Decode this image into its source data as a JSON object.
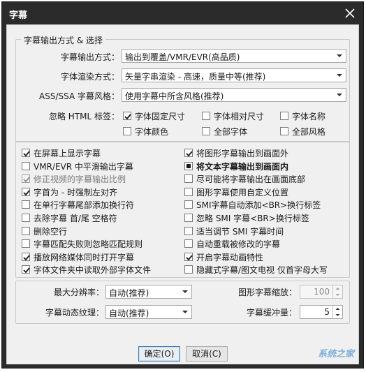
{
  "window": {
    "title": "字幕"
  },
  "output_group": {
    "title": "字幕输出方式 & 选择",
    "output_mode": {
      "label": "字幕输出方式：",
      "value": "输出到覆盖/VMR/EVR(高品质)"
    },
    "font_render": {
      "label": "字体渲染方式：",
      "value": "矢量字串渲染 - 高速，质量中等(推荐)"
    },
    "ass_style": {
      "label": "ASS/SSA 字幕风格：",
      "value": "使用字幕中所含风格(推荐)"
    },
    "html_tags": {
      "label": "忽略 HTML 标签：",
      "options": [
        {
          "label": "字体固定尺寸",
          "checked": true
        },
        {
          "label": "字体相对尺寸",
          "checked": false
        },
        {
          "label": "字体名称",
          "checked": false
        },
        {
          "label": "字体颜色",
          "checked": false
        },
        {
          "label": "全部字体",
          "checked": false
        },
        {
          "label": "全部风格",
          "checked": false
        }
      ]
    }
  },
  "options_left": [
    {
      "label": "在屏幕上显示字幕",
      "state": "checked"
    },
    {
      "label": "VMR/EVR 中平滑输出字幕",
      "state": "unchecked"
    },
    {
      "label": "修正视频的字幕输出比例",
      "state": "checked-disabled"
    },
    {
      "label": "字首为 - 时强制左对齐",
      "state": "checked"
    },
    {
      "label": "在单行字幕尾部添加换行符",
      "state": "unchecked"
    },
    {
      "label": "去除字幕 首/尾 空格符",
      "state": "unchecked"
    },
    {
      "label": "删除空行",
      "state": "unchecked"
    },
    {
      "label": "字幕匹配失败则忽略匹配规则",
      "state": "unchecked"
    },
    {
      "label": "播放网络媒体同时打开字幕",
      "state": "checked"
    },
    {
      "label": "字体文件夹中读取外部字体文件",
      "state": "checked"
    }
  ],
  "options_right": [
    {
      "label": "将图形字幕输出到画面外",
      "state": "checked"
    },
    {
      "label": "将文本字幕输出到画面内",
      "state": "indeterminate",
      "bold": true
    },
    {
      "label": "尽可能将字幕输出在画面底部",
      "state": "unchecked"
    },
    {
      "label": "图形字幕使用自定义位置",
      "state": "unchecked"
    },
    {
      "label": "SMI字幕自动添加<BR>换行标签",
      "state": "unchecked"
    },
    {
      "label": "忽略 SMI 字幕<BR>换行标签",
      "state": "unchecked"
    },
    {
      "label": "适当调节 SMI 字幕时间",
      "state": "unchecked"
    },
    {
      "label": "自动重载被修改的字幕",
      "state": "unchecked"
    },
    {
      "label": "开启字幕动画特性",
      "state": "checked"
    },
    {
      "label": "隐藏式字幕/图文电视 仅首字母大写",
      "state": "unchecked"
    }
  ],
  "bottom": {
    "max_resolution": {
      "label": "最大分辨率：",
      "value": "自动(推荐)"
    },
    "dynamic_texture": {
      "label": "字幕动态纹理：",
      "value": "自动(推荐)"
    },
    "image_scale": {
      "label": "图形字幕缩放：",
      "value": "100"
    },
    "buffer": {
      "label": "字幕缓冲量：",
      "value": "5"
    }
  },
  "buttons": {
    "ok": "确定(O)",
    "cancel": "取消(C)"
  },
  "watermark": "系统之家"
}
